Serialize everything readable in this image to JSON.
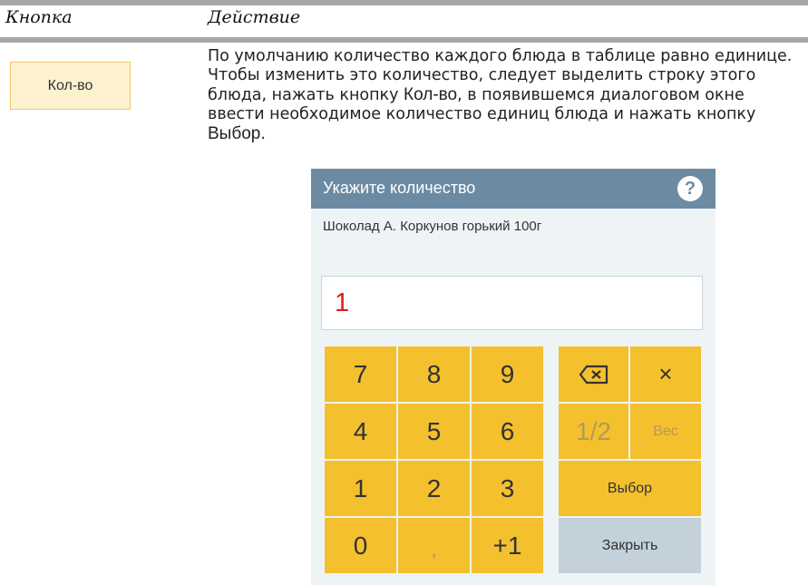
{
  "table": {
    "header_button": "Кнопка",
    "header_action": "Действие"
  },
  "row": {
    "button_label": "Кол-во",
    "desc_part1": "По умолчанию количество каждого блюда в таблице равно единице. Чтобы изменить это количество, следует выделить строку этого блюда, нажать кнопку ",
    "desc_btn1": "Кол-во",
    "desc_part2": ", в появившемся диалоговом окне ввести необходимое количество единиц блюда и нажать кнопку ",
    "desc_btn2": "Выбор",
    "desc_part3": "."
  },
  "dialog": {
    "title": "Укажите количество",
    "help_icon": "?",
    "item_name": "Шоколад А. Коркунов горький 100г",
    "input_value": "1",
    "keys": {
      "k7": "7",
      "k8": "8",
      "k9": "9",
      "k4": "4",
      "k5": "5",
      "k6": "6",
      "k1": "1",
      "k2": "2",
      "k3": "3",
      "k0": "0",
      "comma": ",",
      "plus1": "+1",
      "backspace": "⌫",
      "clear": "×",
      "half": "1/2",
      "weight": "Вес",
      "select": "Выбор",
      "close": "Закрыть"
    }
  },
  "colors": {
    "header_rule": "#a6a6a6",
    "kolvo_button_bg": "#fdf1cf",
    "dialog_title_bg": "#6c8ba3",
    "key_bg": "#f4c02e",
    "close_key_bg": "#c3d2da",
    "input_value": "#e11919"
  }
}
